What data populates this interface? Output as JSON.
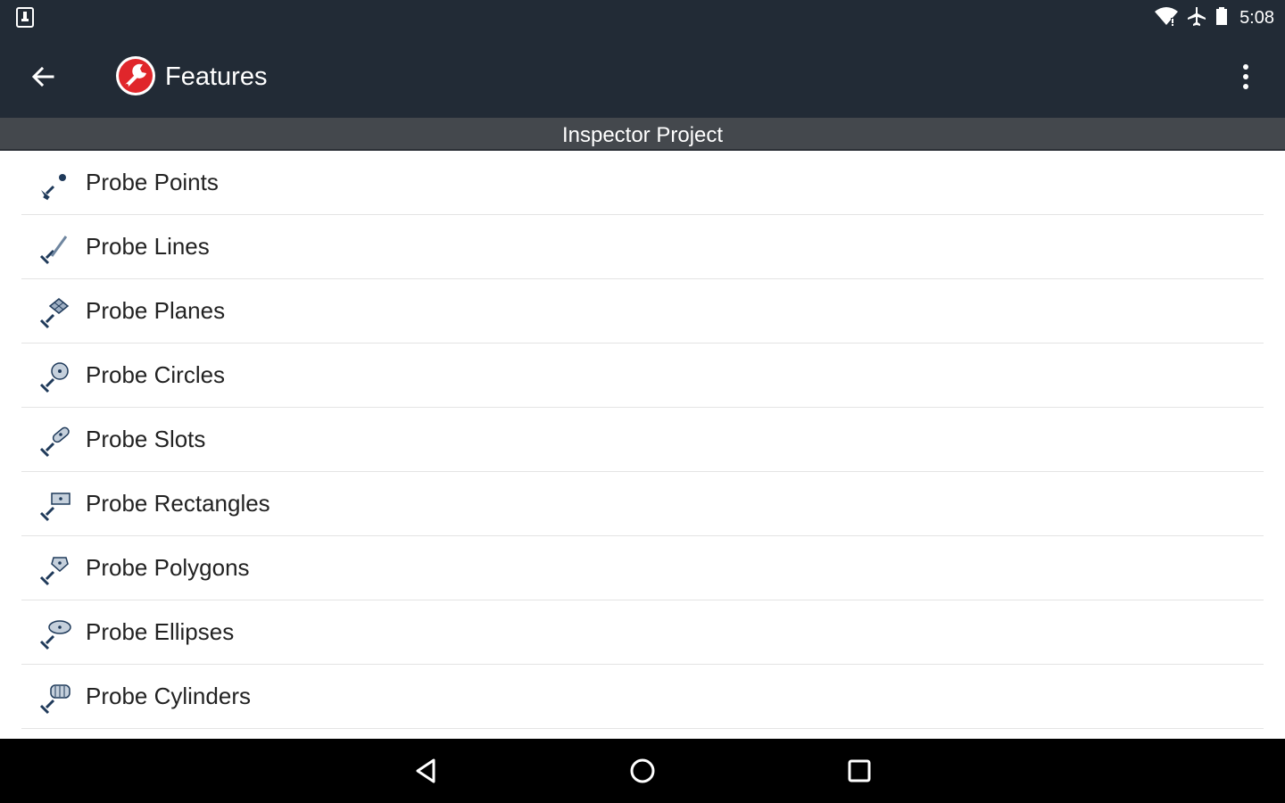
{
  "status_bar": {
    "time": "5:08",
    "icons": [
      "sim-card-icon",
      "wifi-icon",
      "airplane-mode-icon",
      "battery-icon"
    ]
  },
  "app_bar": {
    "title": "Features",
    "back_icon": "arrow-left-icon",
    "logo_icon": "app-logo-icon",
    "overflow_icon": "more-vert-icon"
  },
  "project": {
    "name": "Inspector Project"
  },
  "features": [
    {
      "label": "Probe Points",
      "icon": "probe-points-icon"
    },
    {
      "label": "Probe Lines",
      "icon": "probe-lines-icon"
    },
    {
      "label": "Probe Planes",
      "icon": "probe-planes-icon"
    },
    {
      "label": "Probe Circles",
      "icon": "probe-circles-icon"
    },
    {
      "label": "Probe Slots",
      "icon": "probe-slots-icon"
    },
    {
      "label": "Probe Rectangles",
      "icon": "probe-rectangles-icon"
    },
    {
      "label": "Probe Polygons",
      "icon": "probe-polygons-icon"
    },
    {
      "label": "Probe Ellipses",
      "icon": "probe-ellipses-icon"
    },
    {
      "label": "Probe Cylinders",
      "icon": "probe-cylinders-icon"
    }
  ],
  "nav_bar": {
    "icons": [
      "nav-back-icon",
      "nav-home-icon",
      "nav-recents-icon"
    ]
  },
  "colors": {
    "app_bar": "#222b36",
    "project_bar": "#44484d",
    "logo_red": "#e0262b",
    "icon_navy": "#1f3a5a",
    "icon_accent": "#9fb0c4"
  }
}
